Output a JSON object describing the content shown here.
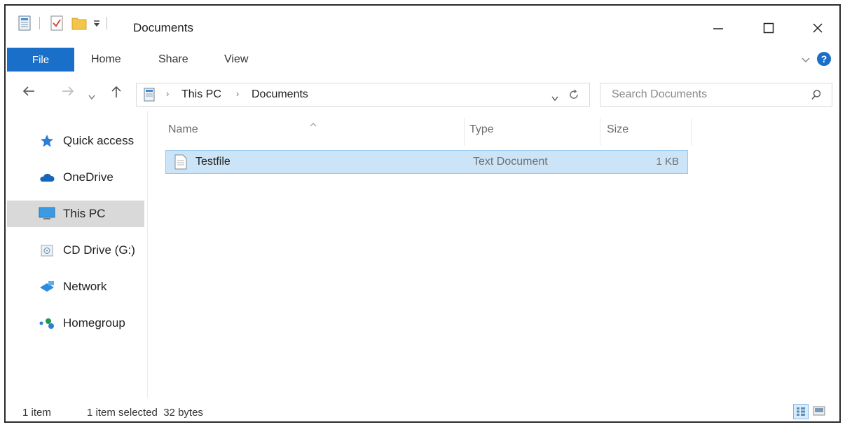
{
  "window": {
    "title": "Documents"
  },
  "ribbon": {
    "tabs": [
      "File",
      "Home",
      "Share",
      "View"
    ]
  },
  "address": {
    "crumbs": [
      "This PC",
      "Documents"
    ]
  },
  "search": {
    "placeholder": "Search Documents"
  },
  "navpane": {
    "items": [
      {
        "label": "Quick access",
        "icon": "star-icon"
      },
      {
        "label": "OneDrive",
        "icon": "cloud-icon"
      },
      {
        "label": "This PC",
        "icon": "computer-icon",
        "selected": true
      },
      {
        "label": "CD Drive (G:)",
        "icon": "cd-drive-icon"
      },
      {
        "label": "Network",
        "icon": "network-icon"
      },
      {
        "label": "Homegroup",
        "icon": "homegroup-icon"
      }
    ]
  },
  "filelist": {
    "columns": [
      "Name",
      "Type",
      "Size"
    ],
    "rows": [
      {
        "name": "Testfile",
        "type": "Text Document",
        "size": "1 KB",
        "selected": true
      }
    ]
  },
  "status": {
    "count": "1 item",
    "selection": "1 item selected  32 bytes"
  },
  "colors": {
    "accent": "#1a6fc8",
    "selection_bg": "#cce4f7",
    "selection_border": "#99c9ef",
    "nav_selected_bg": "#d9d9d9"
  }
}
